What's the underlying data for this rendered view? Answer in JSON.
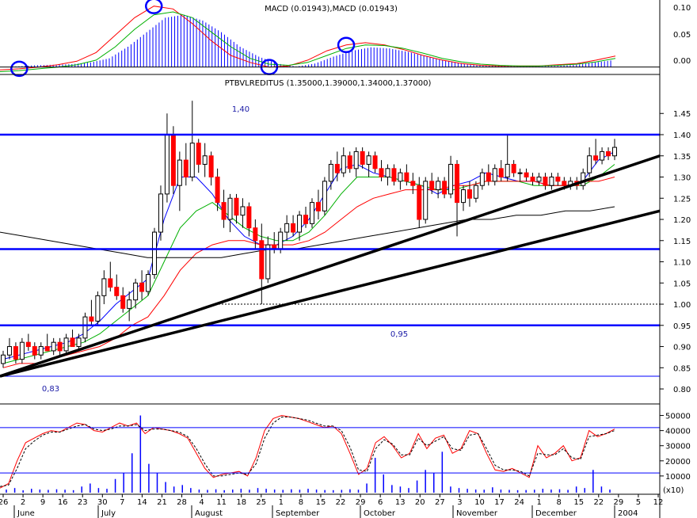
{
  "colors": {
    "background": "#ffffff",
    "bull": "#ffffff",
    "bear": "#ff0000",
    "level_line": "#0000ff",
    "trendline": "#000000",
    "ma_fast": "#0000ff",
    "ma_mid": "#00b000",
    "ma_slow": "#ff0000",
    "ma_long": "#000000",
    "stoch_k": "#ff0000",
    "stoch_d": "#000000",
    "macd_hist": "#0000ff",
    "marker": "#0000ff"
  },
  "macd_panel": {
    "title": "MACD (0.01943),MACD (0.01943)",
    "axis_ticks": [
      "0.10",
      "0.05",
      "0.00"
    ]
  },
  "price_panel": {
    "title": "PTBVLREDITUS (1.35000,1.39000,1.34000,1.37000)",
    "axis_ticks": [
      "1.45",
      "1.40",
      "1.35",
      "1.30",
      "1.25",
      "1.20",
      "1.15",
      "1.10",
      "1.05",
      "1.00",
      "0.95",
      "0.90",
      "0.85",
      "0.80"
    ],
    "annotations": [
      "1,40",
      "0,95",
      "0,83"
    ]
  },
  "stoch_panel": {
    "axis_ticks": [
      "50000",
      "40000",
      "30000",
      "20000",
      "10000"
    ],
    "multiplier": "(x10)"
  },
  "x_axis": {
    "day_ticks": [
      "26",
      "2",
      "9",
      "16",
      "23",
      "30",
      "7",
      "14",
      "21",
      "28",
      "4",
      "11",
      "18",
      "25",
      "1",
      "8",
      "15",
      "22",
      "29",
      "6",
      "13",
      "20",
      "27",
      "3",
      "10",
      "17",
      "24",
      "1",
      "8",
      "15",
      "22",
      "29",
      "5",
      "12"
    ],
    "months": [
      "June",
      "July",
      "August",
      "September",
      "October",
      "November",
      "December",
      "2004"
    ]
  },
  "chart_data": [
    {
      "type": "line",
      "name": "MACD",
      "title": "MACD (0.01943),MACD (0.01943)",
      "y_range": [
        -0.01,
        0.11
      ],
      "series": [
        {
          "values": [
            -0.005,
            -0.003,
            0.0,
            0.004,
            0.01,
            0.025,
            0.055,
            0.085,
            0.105,
            0.1,
            0.075,
            0.045,
            0.02,
            0.008,
            0.0,
            0.002,
            0.012,
            0.028,
            0.038,
            0.042,
            0.038,
            0.03,
            0.02,
            0.012,
            0.006,
            0.003,
            0.002,
            0.002,
            0.002,
            0.004,
            0.006,
            0.012,
            0.019
          ]
        },
        {
          "values": [
            -0.008,
            -0.006,
            -0.003,
            0.0,
            0.004,
            0.012,
            0.035,
            0.065,
            0.09,
            0.095,
            0.085,
            0.06,
            0.035,
            0.015,
            0.005,
            0.003,
            0.008,
            0.02,
            0.032,
            0.038,
            0.037,
            0.032,
            0.024,
            0.015,
            0.009,
            0.005,
            0.003,
            0.002,
            0.002,
            0.003,
            0.005,
            0.009,
            0.015
          ]
        }
      ],
      "histogram": [
        0.001,
        0.003,
        0.004,
        0.005,
        0.008,
        0.015,
        0.035,
        0.06,
        0.085,
        0.09,
        0.08,
        0.06,
        0.035,
        0.018,
        0.006,
        0.001,
        0.006,
        0.018,
        0.028,
        0.034,
        0.032,
        0.026,
        0.018,
        0.011,
        0.006,
        0.003,
        0.002,
        0.001,
        0.001,
        0.002,
        0.004,
        0.008,
        0.012
      ],
      "markers_at": [
        1,
        8,
        14,
        18
      ]
    },
    {
      "type": "candlestick",
      "name": "PTBVLREDITUS",
      "title": "PTBVLREDITUS (1.35000,1.39000,1.34000,1.37000)",
      "y_range": [
        0.78,
        1.49
      ],
      "last": {
        "open": 1.35,
        "high": 1.39,
        "low": 1.34,
        "close": 1.37
      },
      "ohlc": [
        [
          0.86,
          0.89,
          0.85,
          0.88
        ],
        [
          0.88,
          0.92,
          0.87,
          0.9
        ],
        [
          0.9,
          0.91,
          0.86,
          0.87
        ],
        [
          0.87,
          0.92,
          0.86,
          0.91
        ],
        [
          0.91,
          0.93,
          0.89,
          0.9
        ],
        [
          0.9,
          0.91,
          0.87,
          0.88
        ],
        [
          0.88,
          0.91,
          0.87,
          0.9
        ],
        [
          0.9,
          0.93,
          0.89,
          0.89
        ],
        [
          0.89,
          0.92,
          0.88,
          0.91
        ],
        [
          0.91,
          0.92,
          0.88,
          0.89
        ],
        [
          0.89,
          0.93,
          0.88,
          0.92
        ],
        [
          0.92,
          0.94,
          0.9,
          0.9
        ],
        [
          0.9,
          0.93,
          0.89,
          0.92
        ],
        [
          0.92,
          0.98,
          0.91,
          0.97
        ],
        [
          0.97,
          1.01,
          0.95,
          0.96
        ],
        [
          0.96,
          1.03,
          0.95,
          1.02
        ],
        [
          1.02,
          1.08,
          1.0,
          1.06
        ],
        [
          1.06,
          1.1,
          1.03,
          1.04
        ],
        [
          1.04,
          1.07,
          1.01,
          1.02
        ],
        [
          1.02,
          1.04,
          0.98,
          0.99
        ],
        [
          0.99,
          1.03,
          0.96,
          1.01
        ],
        [
          1.01,
          1.06,
          0.99,
          1.05
        ],
        [
          1.05,
          1.08,
          1.01,
          1.03
        ],
        [
          1.03,
          1.08,
          1.02,
          1.07
        ],
        [
          1.07,
          1.18,
          1.06,
          1.17
        ],
        [
          1.17,
          1.28,
          1.15,
          1.26
        ],
        [
          1.26,
          1.45,
          1.24,
          1.4
        ],
        [
          1.4,
          1.42,
          1.26,
          1.28
        ],
        [
          1.28,
          1.36,
          1.22,
          1.34
        ],
        [
          1.34,
          1.38,
          1.28,
          1.3
        ],
        [
          1.3,
          1.48,
          1.29,
          1.38
        ],
        [
          1.38,
          1.39,
          1.31,
          1.33
        ],
        [
          1.33,
          1.38,
          1.3,
          1.35
        ],
        [
          1.35,
          1.36,
          1.28,
          1.3
        ],
        [
          1.3,
          1.32,
          1.22,
          1.24
        ],
        [
          1.24,
          1.27,
          1.18,
          1.2
        ],
        [
          1.2,
          1.26,
          1.17,
          1.25
        ],
        [
          1.25,
          1.26,
          1.19,
          1.21
        ],
        [
          1.21,
          1.25,
          1.18,
          1.23
        ],
        [
          1.23,
          1.24,
          1.16,
          1.18
        ],
        [
          1.18,
          1.2,
          1.13,
          1.15
        ],
        [
          1.15,
          1.19,
          1.0,
          1.06
        ],
        [
          1.06,
          1.16,
          1.05,
          1.14
        ],
        [
          1.14,
          1.17,
          1.12,
          1.13
        ],
        [
          1.13,
          1.18,
          1.12,
          1.17
        ],
        [
          1.17,
          1.21,
          1.15,
          1.19
        ],
        [
          1.19,
          1.21,
          1.16,
          1.17
        ],
        [
          1.17,
          1.22,
          1.15,
          1.21
        ],
        [
          1.21,
          1.23,
          1.18,
          1.19
        ],
        [
          1.19,
          1.25,
          1.18,
          1.24
        ],
        [
          1.24,
          1.27,
          1.2,
          1.22
        ],
        [
          1.22,
          1.3,
          1.21,
          1.29
        ],
        [
          1.29,
          1.34,
          1.27,
          1.33
        ],
        [
          1.33,
          1.36,
          1.29,
          1.31
        ],
        [
          1.31,
          1.37,
          1.3,
          1.35
        ],
        [
          1.35,
          1.36,
          1.31,
          1.32
        ],
        [
          1.32,
          1.37,
          1.3,
          1.36
        ],
        [
          1.36,
          1.37,
          1.32,
          1.33
        ],
        [
          1.33,
          1.36,
          1.3,
          1.35
        ],
        [
          1.35,
          1.36,
          1.31,
          1.32
        ],
        [
          1.32,
          1.34,
          1.29,
          1.3
        ],
        [
          1.3,
          1.33,
          1.28,
          1.32
        ],
        [
          1.32,
          1.33,
          1.28,
          1.29
        ],
        [
          1.29,
          1.32,
          1.27,
          1.31
        ],
        [
          1.31,
          1.33,
          1.28,
          1.29
        ],
        [
          1.29,
          1.31,
          1.26,
          1.28
        ],
        [
          1.28,
          1.3,
          1.18,
          1.2
        ],
        [
          1.2,
          1.3,
          1.19,
          1.29
        ],
        [
          1.29,
          1.31,
          1.26,
          1.27
        ],
        [
          1.27,
          1.3,
          1.25,
          1.29
        ],
        [
          1.29,
          1.3,
          1.25,
          1.26
        ],
        [
          1.26,
          1.35,
          1.25,
          1.33
        ],
        [
          1.33,
          1.34,
          1.16,
          1.24
        ],
        [
          1.24,
          1.28,
          1.22,
          1.27
        ],
        [
          1.27,
          1.29,
          1.23,
          1.25
        ],
        [
          1.25,
          1.29,
          1.24,
          1.28
        ],
        [
          1.28,
          1.32,
          1.27,
          1.31
        ],
        [
          1.31,
          1.33,
          1.28,
          1.29
        ],
        [
          1.29,
          1.33,
          1.28,
          1.32
        ],
        [
          1.32,
          1.34,
          1.29,
          1.3
        ],
        [
          1.3,
          1.4,
          1.29,
          1.33
        ],
        [
          1.33,
          1.34,
          1.3,
          1.31
        ],
        [
          1.31,
          1.32,
          1.29,
          1.31
        ],
        [
          1.31,
          1.32,
          1.29,
          1.3
        ],
        [
          1.3,
          1.31,
          1.28,
          1.29
        ],
        [
          1.29,
          1.31,
          1.28,
          1.3
        ],
        [
          1.3,
          1.31,
          1.27,
          1.28
        ],
        [
          1.28,
          1.31,
          1.27,
          1.3
        ],
        [
          1.3,
          1.31,
          1.28,
          1.29
        ],
        [
          1.29,
          1.3,
          1.27,
          1.28
        ],
        [
          1.28,
          1.3,
          1.27,
          1.29
        ],
        [
          1.29,
          1.3,
          1.27,
          1.28
        ],
        [
          1.28,
          1.32,
          1.27,
          1.31
        ],
        [
          1.31,
          1.37,
          1.3,
          1.35
        ],
        [
          1.35,
          1.39,
          1.33,
          1.34
        ],
        [
          1.34,
          1.37,
          1.33,
          1.36
        ],
        [
          1.36,
          1.37,
          1.34,
          1.35
        ],
        [
          1.35,
          1.39,
          1.34,
          1.37
        ]
      ],
      "moving_averages": [
        {
          "values": [
            0.87,
            0.88,
            0.89,
            0.9,
            0.91,
            0.93,
            0.96,
            1.0,
            1.03,
            1.06,
            1.2,
            1.3,
            1.3,
            1.26,
            1.2,
            1.16,
            1.14,
            1.14,
            1.16,
            1.2,
            1.26,
            1.32,
            1.33,
            1.31,
            1.3,
            1.29,
            1.28,
            1.26,
            1.28,
            1.29,
            1.31,
            1.3,
            1.29,
            1.29,
            1.28,
            1.28,
            1.29,
            1.34,
            1.36
          ]
        },
        {
          "values": [
            0.86,
            0.87,
            0.88,
            0.89,
            0.9,
            0.91,
            0.93,
            0.96,
            0.99,
            1.02,
            1.1,
            1.18,
            1.22,
            1.24,
            1.21,
            1.18,
            1.16,
            1.15,
            1.15,
            1.17,
            1.21,
            1.26,
            1.3,
            1.3,
            1.3,
            1.29,
            1.28,
            1.27,
            1.27,
            1.28,
            1.29,
            1.29,
            1.29,
            1.28,
            1.28,
            1.28,
            1.28,
            1.3,
            1.33
          ]
        },
        {
          "values": [
            0.85,
            0.86,
            0.86,
            0.87,
            0.88,
            0.89,
            0.9,
            0.92,
            0.95,
            0.97,
            1.02,
            1.08,
            1.12,
            1.14,
            1.15,
            1.15,
            1.14,
            1.14,
            1.14,
            1.15,
            1.17,
            1.2,
            1.23,
            1.25,
            1.26,
            1.27,
            1.27,
            1.27,
            1.28,
            1.28,
            1.29,
            1.29,
            1.29,
            1.29,
            1.28,
            1.28,
            1.29,
            1.29,
            1.3
          ]
        },
        {
          "values": [
            1.17,
            1.16,
            1.15,
            1.14,
            1.13,
            1.12,
            1.11,
            1.11,
            1.11,
            1.11,
            1.12,
            1.13,
            1.13,
            1.14,
            1.15,
            1.16,
            1.17,
            1.18,
            1.19,
            1.2,
            1.2,
            1.21,
            1.21,
            1.22,
            1.22,
            1.23
          ]
        }
      ],
      "horizontal_levels": [
        1.4,
        1.13,
        0.95,
        0.83
      ],
      "dotted_level": 1.0,
      "trendlines": [
        {
          "from": [
            0,
            0.83
          ],
          "to": [
            109,
            1.35
          ]
        },
        {
          "from": [
            0,
            0.83
          ],
          "to": [
            109,
            1.22
          ]
        }
      ]
    },
    {
      "type": "line",
      "name": "Oscillator and Volume",
      "y_range": [
        0,
        55000
      ],
      "multiplier": "(x10)",
      "series": [
        {
          "values": [
            2000,
            5000,
            20000,
            32000,
            35000,
            38000,
            40000,
            39000,
            42000,
            45000,
            44000,
            40000,
            39000,
            42000,
            45000,
            43000,
            45000,
            38000,
            42000,
            41000,
            40000,
            38000,
            35000,
            25000,
            15000,
            9000,
            11000,
            12000,
            13000,
            10000,
            22000,
            40000,
            48000,
            50000,
            49000,
            48000,
            46000,
            44000,
            42000,
            43000,
            38000,
            25000,
            11000,
            15000,
            32000,
            36000,
            30000,
            22000,
            25000,
            38000,
            28000,
            35000,
            37000,
            25000,
            28000,
            40000,
            38000,
            25000,
            14000,
            13000,
            15000,
            12000,
            9000,
            30000,
            22000,
            25000,
            30000,
            20000,
            22000,
            40000,
            36000,
            38000,
            41000
          ]
        },
        {
          "values": [
            3000,
            4000,
            15000,
            28000,
            33000,
            37000,
            39000,
            39000,
            41000,
            43000,
            44000,
            41000,
            40000,
            41000,
            43000,
            43000,
            44000,
            40000,
            41000,
            41000,
            40000,
            39000,
            36000,
            28000,
            18000,
            10000,
            10000,
            11000,
            12000,
            11000,
            18000,
            35000,
            45000,
            49000,
            49000,
            48000,
            47000,
            45000,
            43000,
            43000,
            40000,
            29000,
            14000,
            13000,
            28000,
            34000,
            31000,
            24000,
            24000,
            35000,
            30000,
            33000,
            36000,
            28000,
            27000,
            37000,
            38000,
            28000,
            17000,
            14000,
            14000,
            13000,
            10000,
            25000,
            24000,
            24000,
            28000,
            22000,
            21000,
            36000,
            37000,
            38000,
            40000
          ]
        }
      ],
      "volume": [
        1000,
        2000,
        500,
        1500,
        1000,
        800,
        1200,
        900,
        600,
        3000,
        5000,
        2000,
        1500,
        8000,
        12000,
        25000,
        50000,
        18000,
        12000,
        6000,
        3000,
        4000,
        2000,
        1000,
        800,
        1200,
        600,
        1000,
        1500,
        900,
        2000,
        1500,
        1000,
        800,
        1200,
        900,
        1500,
        1000,
        700,
        600,
        800,
        1200,
        900,
        5000,
        22000,
        11000,
        4000,
        3000,
        2000,
        7000,
        14000,
        12000,
        26000,
        3000,
        2000,
        1500,
        1000,
        900,
        2500,
        1000,
        800,
        600,
        700,
        900,
        1500,
        1000,
        1200,
        800,
        3000,
        2000,
        14000,
        3000,
        1000
      ]
    }
  ]
}
